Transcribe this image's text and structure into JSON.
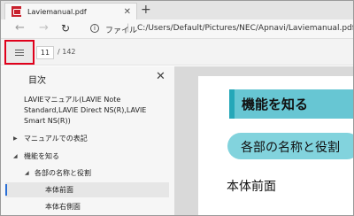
{
  "browser": {
    "tab": {
      "title": "Laviemanual.pdf",
      "close_glyph": "✕"
    },
    "new_tab_glyph": "+",
    "nav": {
      "back_glyph": "←",
      "forward_glyph": "→",
      "reload_glyph": "↻"
    },
    "address": {
      "info_glyph": "i",
      "site_label": "ファイル",
      "separator": "|",
      "url": "C:/Users/Default/Pictures/NEC/Apnavi/Laviemanual.pdf"
    }
  },
  "pdf_toolbar": {
    "current_page": "11",
    "total_pages": "/ 142"
  },
  "toc": {
    "title": "目次",
    "close_glyph": "✕",
    "items": [
      {
        "label": "LAVIEマニュアル(LAVIE Note Standard,LAVIE Direct NS(R),LAVIE Smart NS(R))"
      },
      {
        "label": "マニュアルでの表記",
        "caret": "▶"
      },
      {
        "label": "機能を知る",
        "caret": "◢"
      },
      {
        "label": "各部の名称と役割",
        "caret": "◢"
      },
      {
        "label": "本体前面"
      },
      {
        "label": "本体右側面"
      }
    ]
  },
  "page": {
    "heading": "機能を知る",
    "section": "各部の名称と役割",
    "subsection": "本体前面"
  },
  "colors": {
    "highlight_border": "#e0001b",
    "heading_band": "#67c6d3",
    "pill": "#82d3dd",
    "selection_indicator": "#2b6fd6"
  },
  "icons": [
    "pdf-file-icon",
    "back-arrow-icon",
    "forward-arrow-icon",
    "reload-icon",
    "info-icon",
    "table-of-contents-icon",
    "close-icon"
  ]
}
